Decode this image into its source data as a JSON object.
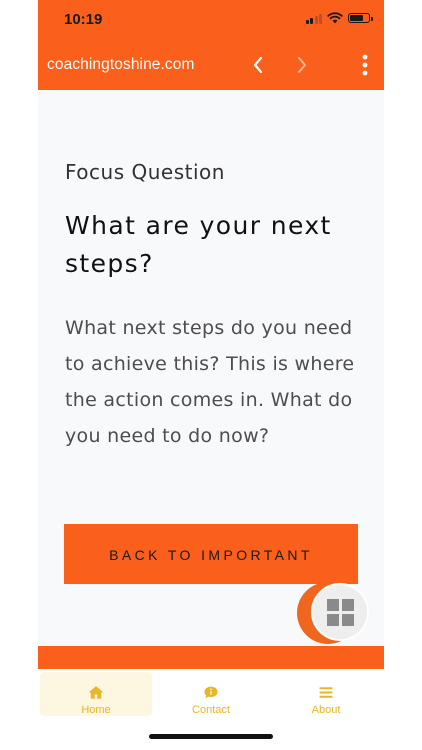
{
  "status_bar": {
    "time": "10:19"
  },
  "browser": {
    "url": "coachingtoshine.com",
    "back_icon": "chevron-left-icon",
    "forward_icon": "chevron-right-icon",
    "menu_icon": "more-vertical-icon"
  },
  "page": {
    "label": "Focus Question",
    "title": "What are your next steps?",
    "body": "What next steps do you need to achieve this?  This is where the action comes in.  What do you need to do now?",
    "button_label": "BACK TO IMPORTANT"
  },
  "floating_button": {
    "icon": "grid-icon"
  },
  "tabs": [
    {
      "label": "Home",
      "icon": "home-icon",
      "selected": true
    },
    {
      "label": "Contact",
      "icon": "chat-info-icon",
      "selected": false
    },
    {
      "label": "About",
      "icon": "menu-lines-icon",
      "selected": false
    }
  ],
  "colors": {
    "brand_orange": "#fa5f1c",
    "tab_gold": "#e8b52b",
    "content_background": "#f8f9fb"
  }
}
